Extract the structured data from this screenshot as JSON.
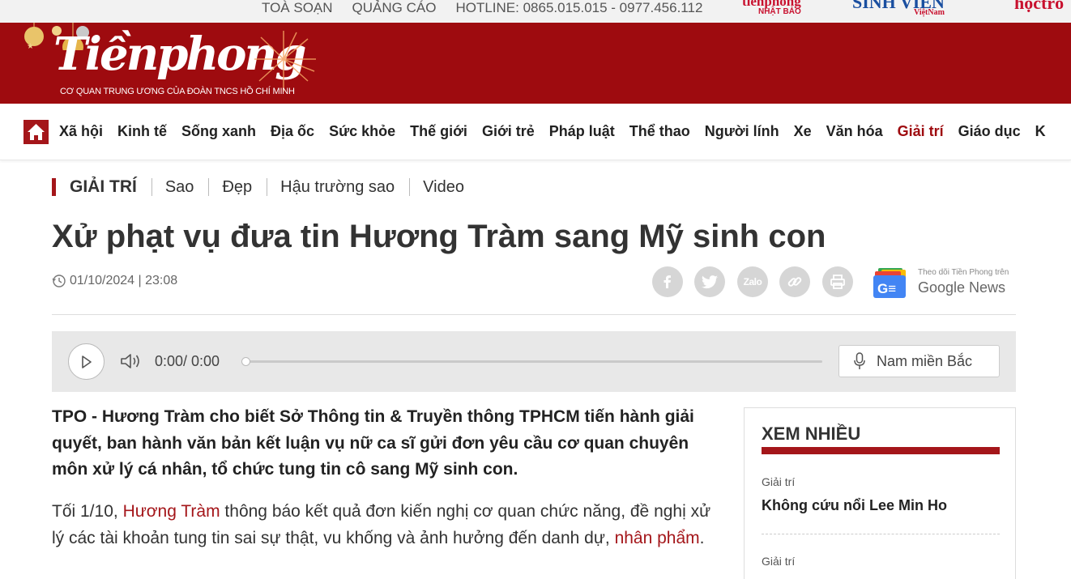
{
  "topbar": {
    "links": [
      "TOÀ SOẠN",
      "QUẢNG CÁO",
      "HOTLINE: 0865.015.015 - 0977.456.112"
    ],
    "partners": {
      "p1_title": "tiềnphong",
      "p1_sub": "NHẬT BẢO",
      "p2_title": "SINH VIÊN",
      "p2_sub": "ViệtNam",
      "p3_title": "họctrò"
    }
  },
  "header": {
    "logo_text": "Tiềnphong",
    "tagline": "CƠ QUAN TRUNG ƯƠNG CỦA ĐOÀN TNCS HỒ CHÍ MINH"
  },
  "nav": {
    "items": [
      "Xã hội",
      "Kinh tế",
      "Sống xanh",
      "Địa ốc",
      "Sức khỏe",
      "Thế giới",
      "Giới trẻ",
      "Pháp luật",
      "Thể thao",
      "Người lính",
      "Xe",
      "Văn hóa",
      "Giải trí",
      "Giáo dục",
      "K"
    ],
    "active": "Giải trí"
  },
  "section": {
    "main": "GIẢI TRÍ",
    "subs": [
      "Sao",
      "Đẹp",
      "Hậu trường sao",
      "Video"
    ]
  },
  "article": {
    "title": "Xử phạt vụ đưa tin Hương Tràm sang Mỹ sinh con",
    "datetime": "01/10/2024 | 23:08",
    "sapo": "TPO - Hương Tràm cho biết Sở Thông tin & Truyền thông TPHCM tiến hành giải quyết, ban hành văn bản kết luận vụ nữ ca sĩ gửi đơn yêu cầu cơ quan chuyên môn xử lý cá nhân, tổ chức tung tin cô sang Mỹ sinh con.",
    "body_p1_before": "Tối 1/10, ",
    "body_p1_link1": "Hương Tràm",
    "body_p1_mid": " thông báo kết quả đơn kiến nghị cơ quan chức năng, đề nghị xử lý các tài khoản tung tin sai sự thật, vu khống và ảnh hưởng đến danh dự, ",
    "body_p1_link2": "nhân phẩm",
    "body_p1_after": "."
  },
  "share": {
    "icons": [
      "facebook-icon",
      "twitter-icon",
      "zalo-icon",
      "link-icon",
      "print-icon"
    ],
    "zalo_label": "Zalo"
  },
  "google_news": {
    "follow_text": "Theo dõi Tiền Phong trên",
    "google": "Google",
    "news": " News",
    "icon_letters": "G≡"
  },
  "player": {
    "time": "0:00/ 0:00",
    "progress": 0,
    "voice_label": "Nam miền Bắc"
  },
  "sidebar": {
    "heading": "XEM NHIỀU",
    "items": [
      {
        "category": "Giải trí",
        "title": "Không cứu nổi Lee Min Ho"
      },
      {
        "category": "Giải trí",
        "title": ""
      }
    ]
  },
  "colors": {
    "brand_red": "#9e0b0f",
    "accent_red": "#a4161a"
  }
}
